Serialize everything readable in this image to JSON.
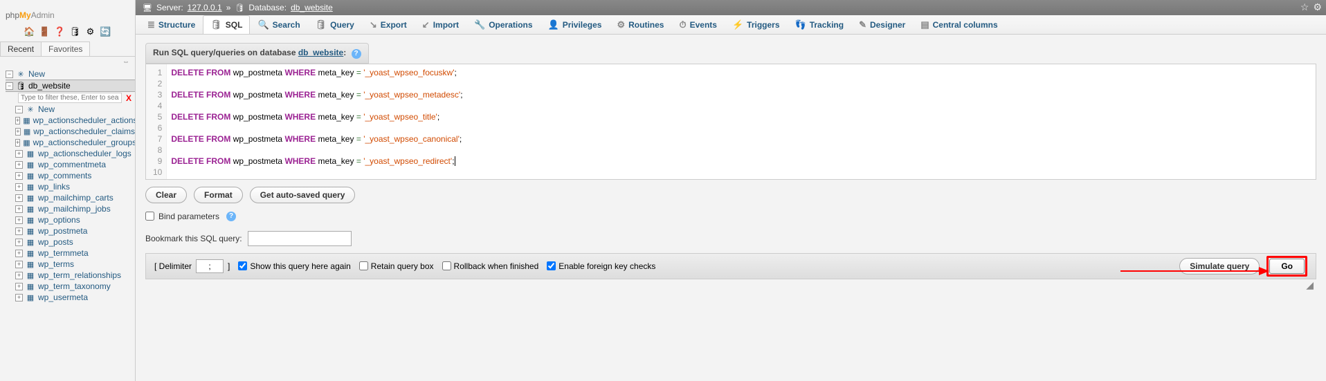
{
  "logo": {
    "php": "php",
    "my": "My",
    "admin": "Admin"
  },
  "icon_bar": {
    "home": "🏠",
    "logout": "🚪",
    "help": "❓",
    "sql": "🛢",
    "gear": "⚙",
    "reload": "🔄"
  },
  "panel_tabs": {
    "recent": "Recent",
    "favorites": "Favorites"
  },
  "collapse_glyph": "⇔",
  "tree": {
    "new": "New",
    "db": "db_website",
    "filter_placeholder": "Type to filter these, Enter to sear",
    "filter_x": "X",
    "new_table": "New",
    "tables": [
      "wp_actionscheduler_actions",
      "wp_actionscheduler_claims",
      "wp_actionscheduler_groups",
      "wp_actionscheduler_logs",
      "wp_commentmeta",
      "wp_comments",
      "wp_links",
      "wp_mailchimp_carts",
      "wp_mailchimp_jobs",
      "wp_options",
      "wp_postmeta",
      "wp_posts",
      "wp_termmeta",
      "wp_terms",
      "wp_term_relationships",
      "wp_term_taxonomy",
      "wp_usermeta"
    ]
  },
  "breadcrumb": {
    "server_label": "Server:",
    "server_val": "127.0.0.1",
    "sep": "»",
    "db_label": "Database:",
    "db_val": "db_website"
  },
  "tabs": [
    {
      "icon": "≣",
      "label": "Structure"
    },
    {
      "icon": "🛢",
      "label": "SQL"
    },
    {
      "icon": "🔍",
      "label": "Search"
    },
    {
      "icon": "🛢",
      "label": "Query"
    },
    {
      "icon": "↘",
      "label": "Export"
    },
    {
      "icon": "↙",
      "label": "Import"
    },
    {
      "icon": "🔧",
      "label": "Operations"
    },
    {
      "icon": "👤",
      "label": "Privileges"
    },
    {
      "icon": "⚙",
      "label": "Routines"
    },
    {
      "icon": "⏱",
      "label": "Events"
    },
    {
      "icon": "⚡",
      "label": "Triggers"
    },
    {
      "icon": "👣",
      "label": "Tracking"
    },
    {
      "icon": "✎",
      "label": "Designer"
    },
    {
      "icon": "▤",
      "label": "Central columns"
    }
  ],
  "active_tab_index": 1,
  "query_header": {
    "prefix": "Run SQL query/queries on database ",
    "link": "db_website",
    "suffix": ":"
  },
  "sql": {
    "kw_delete": "DELETE",
    "kw_from": "FROM",
    "kw_where": "WHERE",
    "table": "wp_postmeta",
    "col": "meta_key",
    "lines": [
      "'_yoast_wpseo_focuskw'",
      "'_yoast_wpseo_metadesc'",
      "'_yoast_wpseo_title'",
      "'_yoast_wpseo_canonical'",
      "'_yoast_wpseo_redirect'"
    ],
    "line_numbers": [
      "1",
      "2",
      "3",
      "4",
      "5",
      "6",
      "7",
      "8",
      "9",
      "10"
    ]
  },
  "buttons": {
    "clear": "Clear",
    "format": "Format",
    "autosaved": "Get auto-saved query"
  },
  "bind_params": "Bind parameters",
  "bookmark_label": "Bookmark this SQL query:",
  "footer": {
    "delimiter_label": "[ Delimiter",
    "delimiter_val": ";",
    "delimiter_close": "]",
    "show_again": "Show this query here again",
    "retain_box": "Retain query box",
    "rollback": "Rollback when finished",
    "fk_checks": "Enable foreign key checks",
    "simulate": "Simulate query",
    "go": "Go"
  }
}
